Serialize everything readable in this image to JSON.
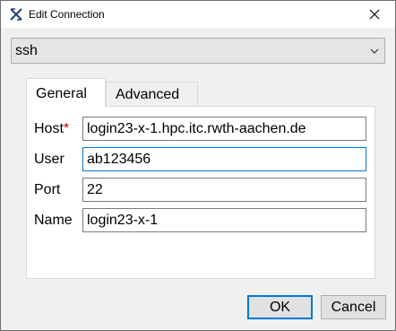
{
  "window": {
    "title": "Edit Connection",
    "icon": "app-x-icon",
    "close_icon": "close-icon"
  },
  "protocol": {
    "selected": "ssh",
    "icon": "chevron-down-icon"
  },
  "tabs": [
    {
      "label": "General",
      "active": true
    },
    {
      "label": "Advanced",
      "active": false
    }
  ],
  "fields": {
    "host": {
      "label": "Host",
      "required_marker": "*",
      "value": "login23-x-1.hpc.itc.rwth-aachen.de"
    },
    "user": {
      "label": "User",
      "value": "ab123456"
    },
    "port": {
      "label": "Port",
      "value": "22"
    },
    "name": {
      "label": "Name",
      "value": "login23-x-1"
    }
  },
  "buttons": {
    "ok": "OK",
    "cancel": "Cancel"
  },
  "colors": {
    "accent": "#0078d7",
    "required": "#c00000",
    "dialog_bg": "#f0f0f0"
  }
}
